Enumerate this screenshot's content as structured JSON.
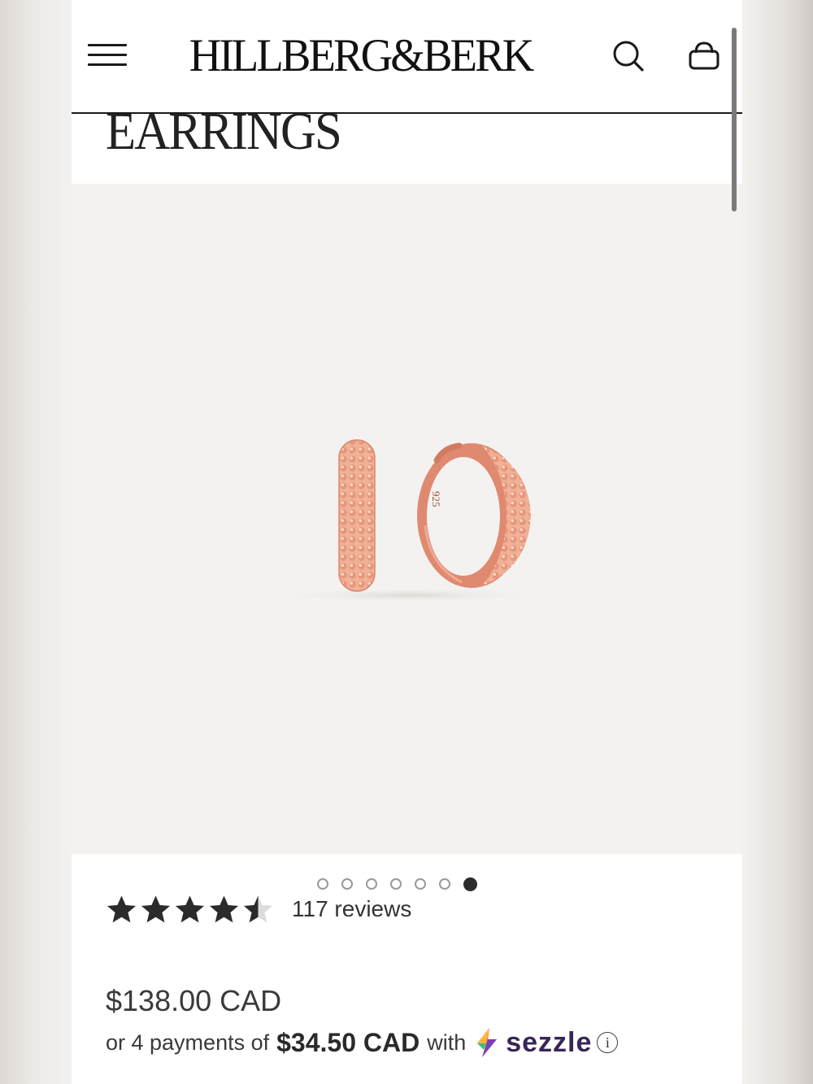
{
  "header": {
    "brand": "HILLBERG&BERK",
    "menu_icon": "hamburger-menu-icon",
    "search_icon": "search-icon",
    "cart_icon": "shopping-bag-icon"
  },
  "page": {
    "title": "EARRINGS"
  },
  "gallery": {
    "image_count": 7,
    "active_index": 7,
    "image_engraving": "925"
  },
  "rating": {
    "stars": 4.5,
    "max_stars": 5,
    "reviews_label": "117 reviews"
  },
  "pricing": {
    "price": "$138.00 CAD",
    "installment_prefix": "or 4 payments of",
    "installment_amount": "$34.50 CAD",
    "installment_suffix": "with",
    "provider": "sezzle",
    "info_icon": "info-icon"
  },
  "colors": {
    "brand_text": "#111111",
    "rose_gold": "#e89a80",
    "sezzle_purple": "#392558",
    "star_fill": "#2b2b2b"
  }
}
